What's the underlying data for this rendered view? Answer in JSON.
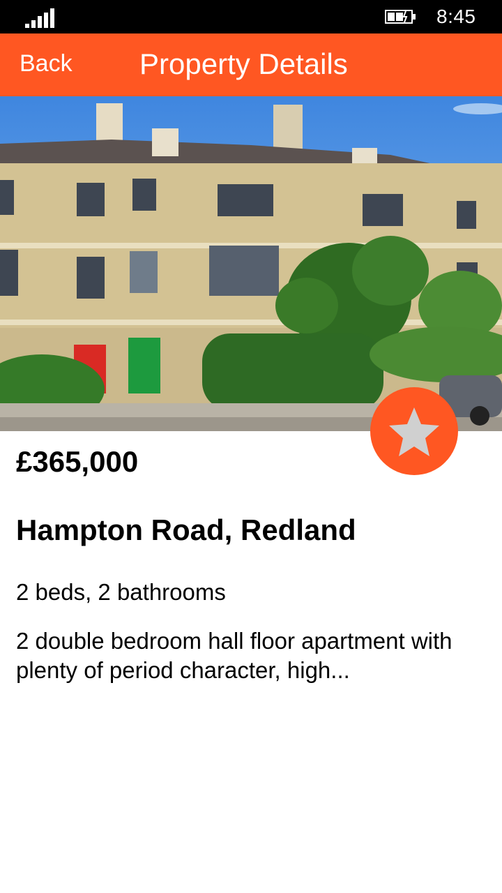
{
  "status_bar": {
    "time": "8:45",
    "signal_icon": "signal-bars-icon",
    "battery_icon": "battery-charging-icon"
  },
  "header": {
    "back_label": "Back",
    "title": "Property Details",
    "background_color": "#ff5722"
  },
  "property": {
    "image": "building-photo",
    "price": "£365,000",
    "address": "Hampton Road, Redland",
    "rooms": "2 beds, 2 bathrooms",
    "description": "2 double bedroom hall floor apartment with plenty of period character, high..."
  },
  "favourite": {
    "icon": "star-icon",
    "button_color": "#ff5722",
    "icon_color": "#d0d0d0"
  }
}
